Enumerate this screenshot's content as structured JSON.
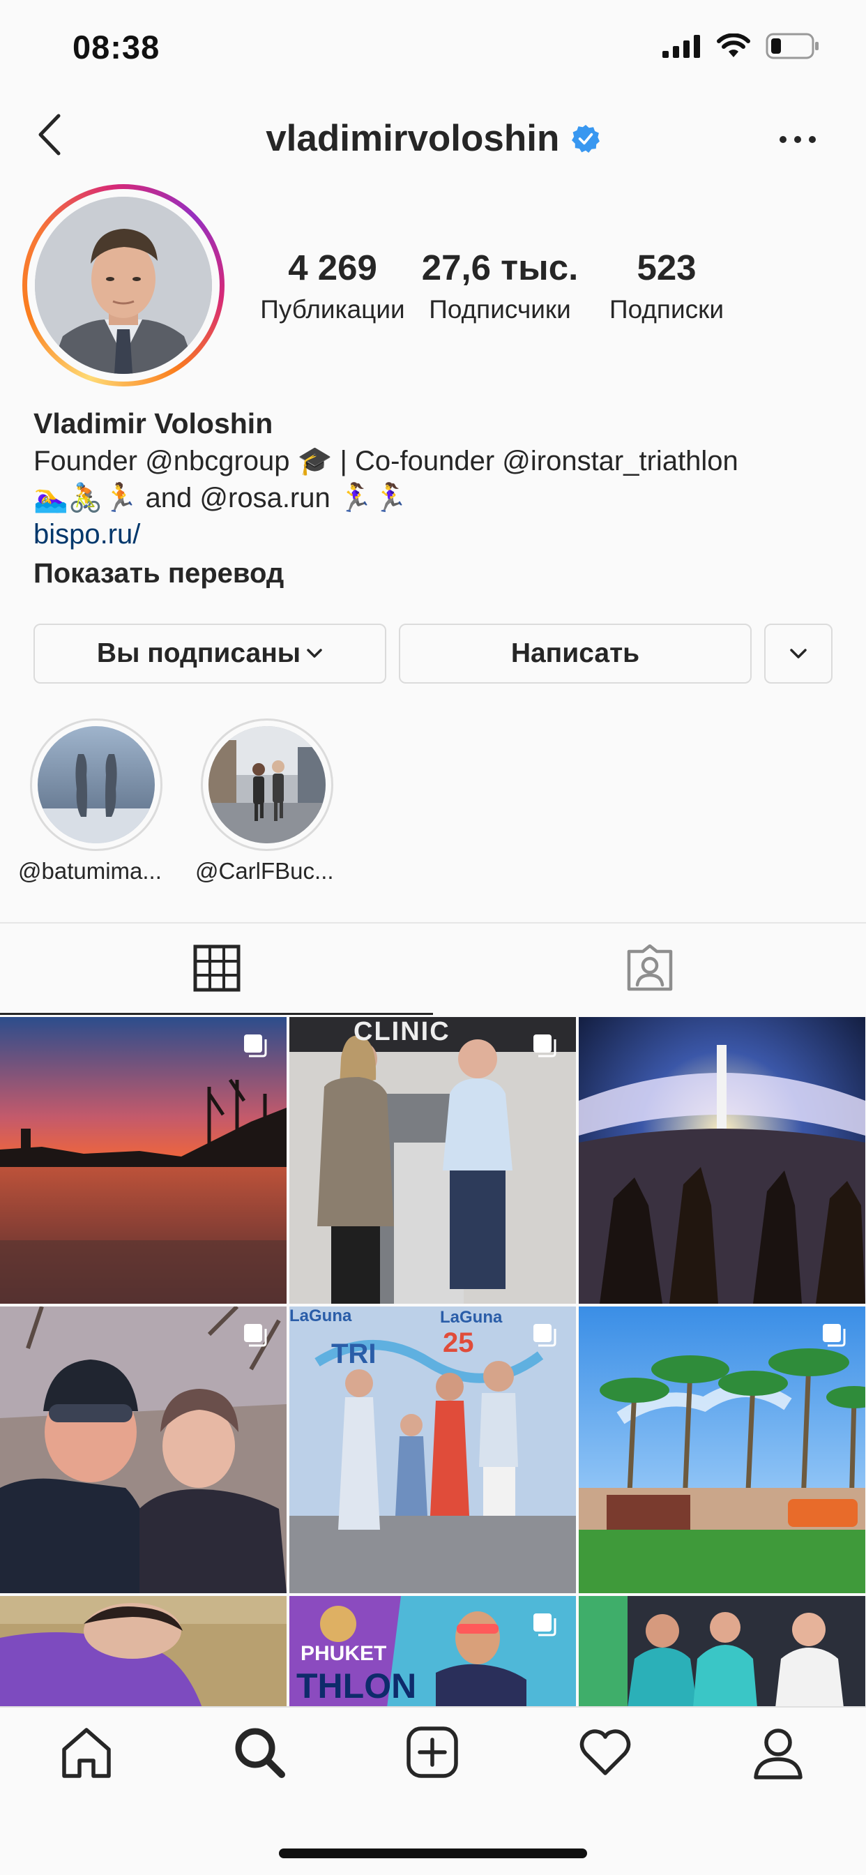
{
  "status_bar": {
    "time": "08:38"
  },
  "header": {
    "username": "vladimirvoloshin"
  },
  "profile": {
    "stats": [
      {
        "value": "4 269",
        "label": "Публикации"
      },
      {
        "value": "27,6 тыс.",
        "label": "Подписчики"
      },
      {
        "value": "523",
        "label": "Подписки"
      }
    ],
    "full_name": "Vladimir Voloshin",
    "bio_line_1": "Founder @nbcgroup 🎓 | Co-founder @ironstar_triathlon",
    "bio_line_2_emoji": "🏊‍♀️🚴🏃",
    "bio_line_2_text": "and @rosa.run",
    "bio_line_2_emoji_end": "🏃‍♀️🏃‍♀️",
    "link": "bispo.ru/",
    "translate": "Показать перевод"
  },
  "actions": {
    "following_label": "Вы подписаны",
    "message_label": "Написать"
  },
  "highlights": [
    {
      "label": "@batumima..."
    },
    {
      "label": "@CarlFBuc..."
    }
  ],
  "colors": {
    "link": "#00376b",
    "verified": "#3897f0",
    "border": "#dbdbdb",
    "text": "#262626"
  },
  "icons": {
    "tabs": [
      "grid-icon",
      "tagged-icon"
    ],
    "nav": [
      "home-icon",
      "search-icon",
      "new-post-icon",
      "activity-heart-icon",
      "profile-icon"
    ]
  },
  "grid_posts": [
    {
      "multi": true
    },
    {
      "multi": true,
      "text": "CLINIC"
    },
    {
      "multi": false
    },
    {
      "multi": true
    },
    {
      "multi": true,
      "text_left": "LaGuna",
      "text_right": "LaGuna",
      "text_mid": "TRI",
      "text_mid2": "25"
    },
    {
      "multi": true
    },
    {
      "multi": false
    },
    {
      "multi": true,
      "text": "PHUKET",
      "text2": "THLON"
    },
    {
      "multi": false
    }
  ]
}
